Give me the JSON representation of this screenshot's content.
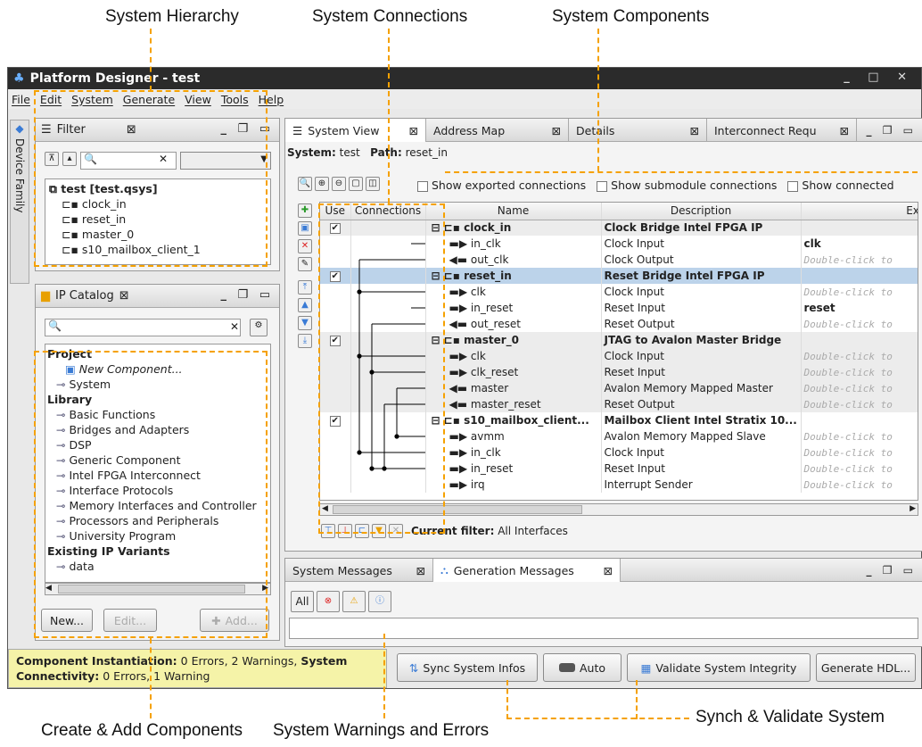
{
  "callouts": {
    "hierarchy": "System Hierarchy",
    "connections": "System Connections",
    "components": "System Components",
    "create": "Create & Add Components",
    "warnings": "System Warnings and Errors",
    "sync": "Synch & Validate System"
  },
  "window": {
    "title": "Platform Designer - test",
    "controls": "_ □ ✕"
  },
  "menu": [
    "File",
    "Edit",
    "System",
    "Generate",
    "View",
    "Tools",
    "Help"
  ],
  "side_tab": "Device Family",
  "hierarchy": {
    "title": "Filter",
    "close": "⊠",
    "root": "test [test.qsys]",
    "items": [
      "clock_in",
      "reset_in",
      "master_0",
      "s10_mailbox_client_1"
    ]
  },
  "ipcatalog": {
    "title": "IP Catalog",
    "close": "⊠",
    "tree": [
      {
        "t": "Project",
        "b": true,
        "i": 0
      },
      {
        "t": "New Component...",
        "it": true,
        "i": 2
      },
      {
        "t": "System",
        "i": 1
      },
      {
        "t": "Library",
        "b": true,
        "i": 0
      },
      {
        "t": "Basic Functions",
        "i": 1
      },
      {
        "t": "Bridges and Adapters",
        "i": 1
      },
      {
        "t": "DSP",
        "i": 1
      },
      {
        "t": "Generic Component",
        "i": 1
      },
      {
        "t": "Intel FPGA Interconnect",
        "i": 1
      },
      {
        "t": "Interface Protocols",
        "i": 1
      },
      {
        "t": "Memory Interfaces and Controller",
        "i": 1
      },
      {
        "t": "Processors and Peripherals",
        "i": 1
      },
      {
        "t": "University Program",
        "i": 1
      },
      {
        "t": "Existing IP Variants",
        "b": true,
        "i": 0
      },
      {
        "t": "data",
        "i": 1
      }
    ],
    "new_btn": "New...",
    "edit_btn": "Edit...",
    "add_btn": "Add..."
  },
  "tabs": [
    "System View",
    "Address Map",
    "Details",
    "Interconnect Requ"
  ],
  "system_path": {
    "system_label": "System:",
    "system": "test",
    "path_label": "Path:",
    "path": "reset_in"
  },
  "opts": {
    "exported": "Show exported connections",
    "submodule": "Show submodule connections",
    "connected": "Show connected"
  },
  "cols": [
    "Use",
    "Connections",
    "Name",
    "Description",
    "Export"
  ],
  "rows": [
    {
      "n": "clock_in",
      "d": "Clock Bridge Intel FPGA IP",
      "e": "",
      "top": 1,
      "cls": "gray"
    },
    {
      "n": "in_clk",
      "d": "Clock Input",
      "e": "clk"
    },
    {
      "n": "out_clk",
      "d": "Clock Output",
      "e": "Double-click to"
    },
    {
      "n": "reset_in",
      "d": "Reset Bridge Intel FPGA IP",
      "e": "",
      "top": 1,
      "cls": "sel"
    },
    {
      "n": "clk",
      "d": "Clock Input",
      "e": "Double-click to"
    },
    {
      "n": "in_reset",
      "d": "Reset Input",
      "e": "reset"
    },
    {
      "n": "out_reset",
      "d": "Reset Output",
      "e": "Double-click to"
    },
    {
      "n": "master_0",
      "d": "JTAG to Avalon Master Bridge",
      "e": "",
      "top": 1,
      "cls": "gray"
    },
    {
      "n": "clk",
      "d": "Clock Input",
      "e": "Double-click to",
      "cls": "gray"
    },
    {
      "n": "clk_reset",
      "d": "Reset Input",
      "e": "Double-click to",
      "cls": "gray"
    },
    {
      "n": "master",
      "d": "Avalon Memory Mapped Master",
      "e": "Double-click to",
      "cls": "gray"
    },
    {
      "n": "master_reset",
      "d": "Reset Output",
      "e": "Double-click to",
      "cls": "gray"
    },
    {
      "n": "s10_mailbox_client...",
      "d": "Mailbox Client Intel Stratix 10...",
      "e": "",
      "top": 1
    },
    {
      "n": "avmm",
      "d": "Avalon Memory Mapped Slave",
      "e": "Double-click to"
    },
    {
      "n": "in_clk",
      "d": "Clock Input",
      "e": "Double-click to"
    },
    {
      "n": "in_reset",
      "d": "Reset Input",
      "e": "Double-click to"
    },
    {
      "n": "irq",
      "d": "Interrupt Sender",
      "e": "Double-click to"
    }
  ],
  "filter": {
    "label": "Current filter:",
    "value": "All Interfaces"
  },
  "msgs": {
    "tab1": "System Messages",
    "tab2": "Generation Messages",
    "all": "All"
  },
  "status": {
    "l1a": "Component Instantiation:",
    "l1b": "0 Errors, 2 Warnings,",
    "l1c": "System",
    "l2a": "Connectivity:",
    "l2b": "0 Errors, 1 Warning"
  },
  "buttons": {
    "sync": "Sync System Infos",
    "auto": "Auto",
    "validate": "Validate System Integrity",
    "gen": "Generate HDL..."
  },
  "colors": {
    "callout": "#f5a100",
    "selected": "#bcd3ea",
    "status_bg": "#f5f3a8"
  }
}
